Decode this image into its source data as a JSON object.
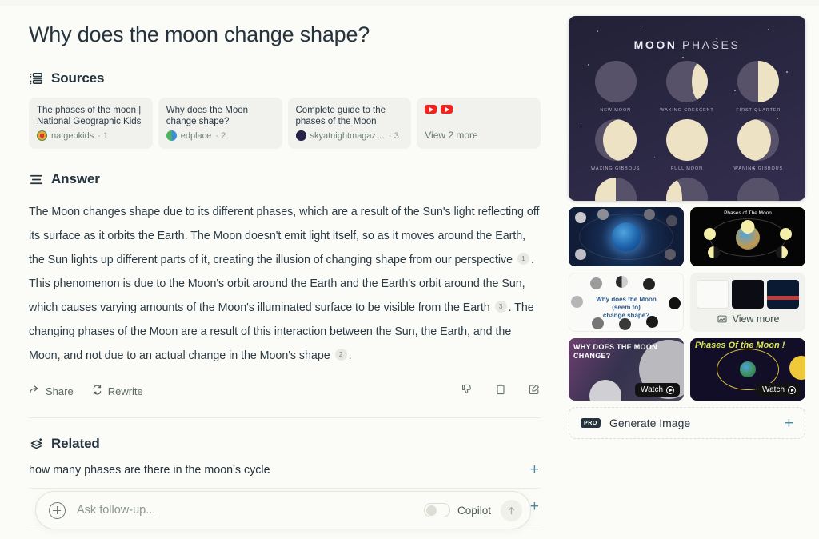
{
  "page": {
    "background": "#FBFBF7",
    "accent": "#4E87A0",
    "text": "#24333D"
  },
  "query": {
    "title": "Why does the moon change shape?"
  },
  "sources": {
    "heading": "Sources",
    "icon": "sources-list-icon",
    "cards": [
      {
        "title": "The phases of the moon | National Geographic Kids",
        "domain": "natgeokids",
        "index": "1",
        "favicon_color": "#E8A33D"
      },
      {
        "title": "Why does the Moon change shape?",
        "domain": "edplace",
        "index": "2",
        "favicon_color": "#5BBF4F"
      },
      {
        "title": "Complete guide to the phases of the Moon",
        "domain": "skyatnightmagaz…",
        "index": "3",
        "favicon_color": "#262349"
      }
    ],
    "more_card": {
      "label": "View 2 more",
      "icon": "youtube-icon",
      "icon_count": 2,
      "icon_color": "#F0231F"
    }
  },
  "answer": {
    "heading": "Answer",
    "icon": "answer-lines-icon",
    "paragraph_parts": {
      "p1": "The Moon changes shape due to its different phases, which are a result of the Sun's light reflecting off its surface as it orbits the Earth. The Moon doesn't emit light itself, so as it moves around the Earth, the Sun lights up different parts of it, creating the illusion of changing shape from our perspective",
      "c1": "1",
      "p2": ". This phenomenon is due to the Moon's orbit around the Earth and the Earth's orbit around the Sun, which causes varying amounts of the Moon's illuminated surface to be visible from the Earth",
      "c2": "3",
      "p3": ". The changing phases of the Moon are a result of this interaction between the Sun, the Earth, and the Moon, and not due to an actual change in the Moon's shape",
      "c3": "2",
      "p4": "."
    }
  },
  "action_bar": {
    "share_label": "Share",
    "rewrite_label": "Rewrite",
    "icons": [
      "thumbs-down-icon",
      "copy-clipboard-icon",
      "edit-pencil-icon"
    ]
  },
  "related": {
    "heading": "Related",
    "icon": "related-layers-icon",
    "items": [
      {
        "text": "how many phases are there in the moon's cycle",
        "action": "+"
      },
      {
        "text": "",
        "action": "+"
      }
    ]
  },
  "followup": {
    "placeholder": "Ask follow-up...",
    "add_icon": "plus-circle-icon",
    "copilot_label": "Copilot",
    "copilot_enabled": false,
    "send_icon": "arrow-up-icon"
  },
  "media": {
    "hero": {
      "title_bold": "MOON",
      "title_light": "PHASES",
      "phases": [
        {
          "label": "NEW MOON",
          "kind": "new"
        },
        {
          "label": "WAXING CRESCENT",
          "kind": "waxing-crescent"
        },
        {
          "label": "FIRST QUARTER",
          "kind": "first-quarter"
        },
        {
          "label": "WAXING GIBBOUS",
          "kind": "waxing-gibbous"
        },
        {
          "label": "FULL MOON",
          "kind": "full"
        },
        {
          "label": "WANING GIBBOUS",
          "kind": "waning-gibbous"
        },
        {
          "label": "",
          "kind": "last-quarter"
        },
        {
          "label": "",
          "kind": "waning-crescent"
        },
        {
          "label": "",
          "kind": "new2"
        }
      ]
    },
    "thumbs": [
      {
        "id": "earth-moon-orbit-diagram",
        "caption": ""
      },
      {
        "id": "phases-of-the-moon-diagram",
        "caption": "Phases of The Moon"
      },
      {
        "id": "why-does-the-moon-seem-to-change-shape",
        "caption": "Why does the Moon\n(seem to)\nchange shape?"
      }
    ],
    "view_more": {
      "label": "View more",
      "icon": "images-icon"
    },
    "videos": [
      {
        "title": "WHY DOES THE MOON CHANGE?",
        "watch_label": "Watch"
      },
      {
        "title": "Phases Of the Moon !",
        "watch_label": "Watch"
      }
    ],
    "generate_image": {
      "badge": "PRO",
      "label": "Generate Image",
      "action": "+"
    }
  }
}
